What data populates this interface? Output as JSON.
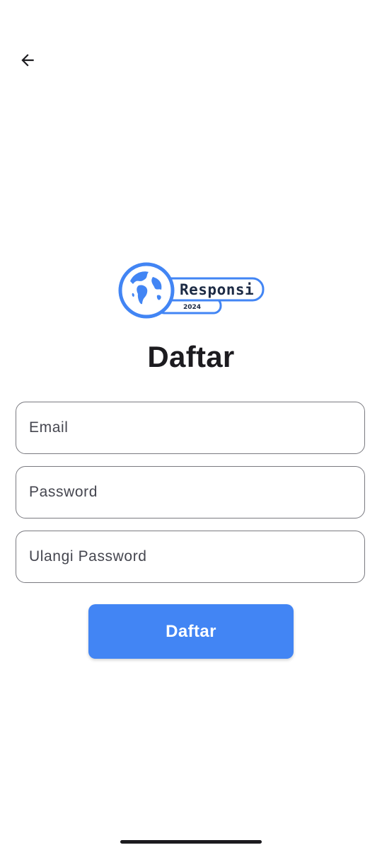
{
  "app_bar": {
    "back_icon": "arrow-back-icon"
  },
  "logo": {
    "brand_text": "Responsi",
    "year_text": "2024",
    "icon": "globe-icon",
    "color": "#4285f4"
  },
  "page": {
    "title": "Daftar"
  },
  "form": {
    "email": {
      "placeholder": "Email",
      "value": ""
    },
    "password": {
      "placeholder": "Password",
      "value": ""
    },
    "confirm_password": {
      "placeholder": "Ulangi Password",
      "value": ""
    }
  },
  "actions": {
    "submit_label": "Daftar",
    "submit_color": "#4285f4"
  }
}
